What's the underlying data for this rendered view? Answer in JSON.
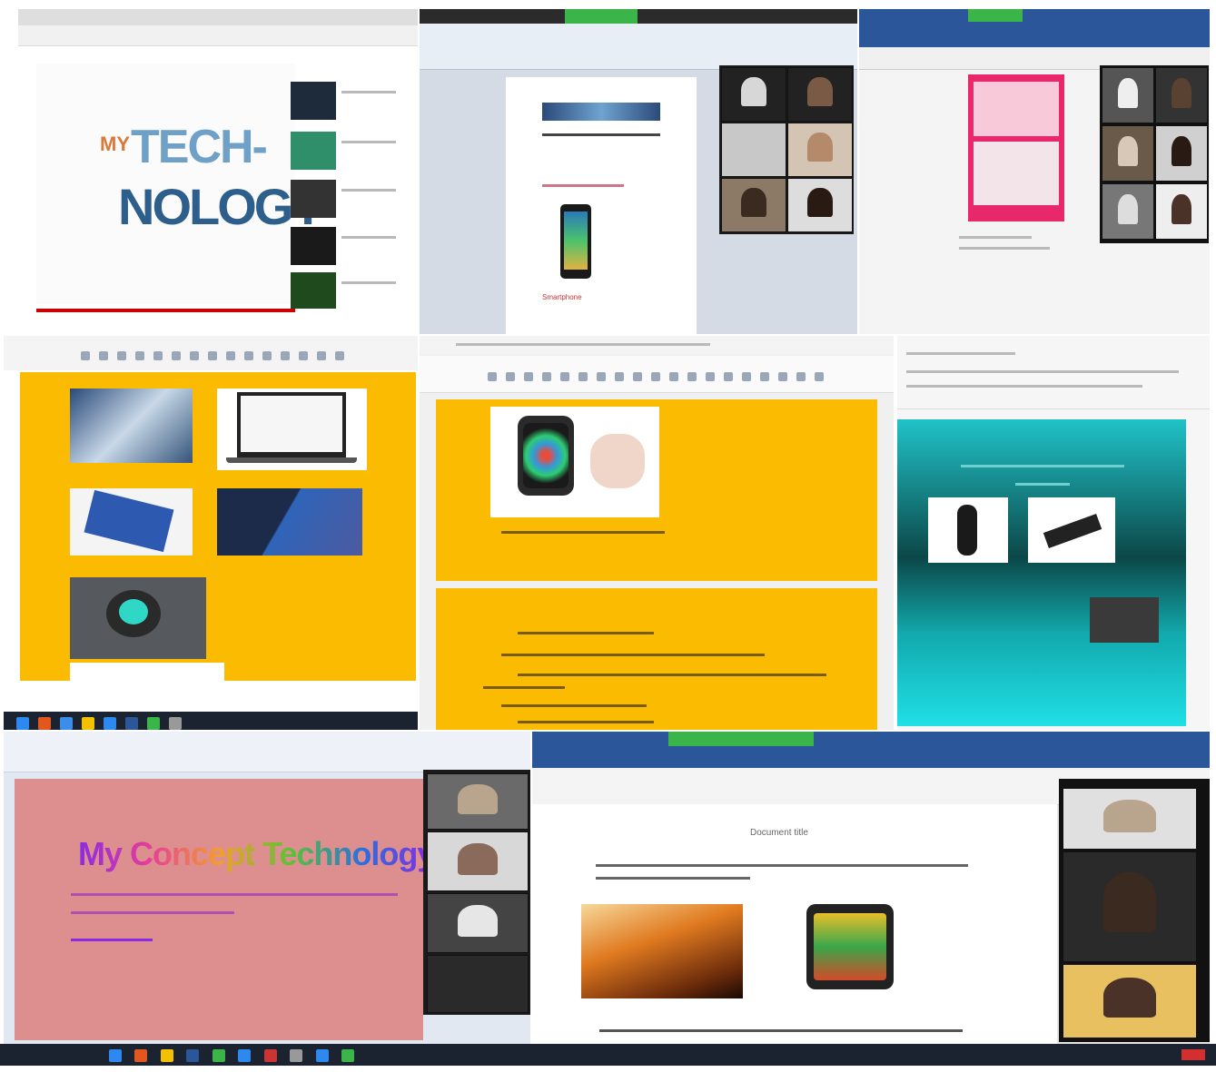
{
  "tile1": {
    "logo_line1": "TECH-",
    "logo_line2": "NOLOGY",
    "logo_prefix": "MY",
    "colors": {
      "blue": "#2d5e8c",
      "orange": "#d9793a",
      "sidebar": "#f7f7f7"
    }
  },
  "tile2": {
    "doc_caption": "Smartphone",
    "colors": {
      "ribbon": "#e8eef6",
      "page": "#ffffff",
      "accent": "#3bb54a"
    }
  },
  "tile3": {
    "colors": {
      "poster": "#e8286b",
      "ribbon": "#2b579a"
    }
  },
  "tile4": {
    "colors": {
      "bg": "#fbbb00"
    }
  },
  "tile5": {
    "colors": {
      "bg": "#fbbb00"
    }
  },
  "tile6": {
    "colors": {
      "teal": "#17c6c9",
      "dark": "#0a2a2a"
    }
  },
  "tile7": {
    "title": "My Concept Technology",
    "colors": {
      "bg": "#dd8f8f",
      "title": "#8a2be2"
    }
  },
  "tile8": {
    "doc_title": "Document title",
    "colors": {
      "ribbon": "#2b579a",
      "page": "#ffffff"
    }
  },
  "icons": {
    "zoom": "video-icon",
    "taskbar": "windows-taskbar-icon"
  }
}
